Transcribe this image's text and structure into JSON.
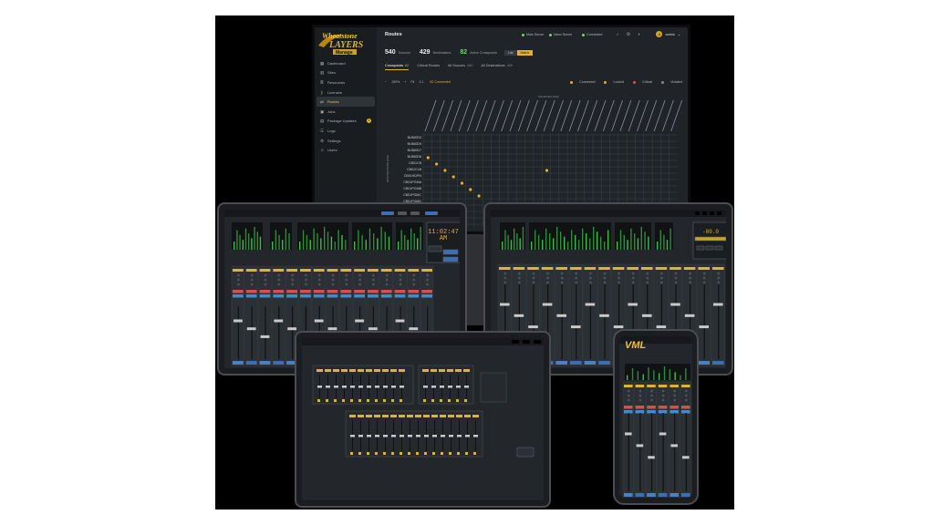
{
  "colors": {
    "accent": "#e3b12b",
    "green": "#6ed36e",
    "background": "#000000"
  },
  "logo": {
    "line1": "Wheatstone",
    "line2": "LAYERS",
    "line3": "Manage"
  },
  "sidebar": {
    "items": [
      {
        "label": "Dashboard",
        "icon": "grid-icon"
      },
      {
        "label": "Sites",
        "icon": "building-icon"
      },
      {
        "label": "Resources",
        "icon": "stack-icon"
      },
      {
        "label": "Licenses",
        "icon": "key-icon"
      },
      {
        "label": "Routes",
        "icon": "route-icon",
        "active": true
      },
      {
        "label": "Jobs",
        "icon": "briefcase-icon"
      },
      {
        "label": "Package Updates",
        "icon": "package-icon",
        "badge": "1"
      },
      {
        "label": "Logs",
        "icon": "list-icon"
      },
      {
        "label": "Settings",
        "icon": "gear-icon"
      },
      {
        "label": "Users",
        "icon": "users-icon"
      }
    ]
  },
  "header": {
    "title": "Routes",
    "main_server": "Main Server",
    "nano_server": "Nano Server",
    "connected": "Connected",
    "user": "admin",
    "user_initial": "A"
  },
  "stats": {
    "sources_count": "540",
    "sources_label": "Sources",
    "destinations_count": "429",
    "destinations_label": "Destinations",
    "crosspoints_count": "82",
    "crosspoints_label": "Active Crosspoints",
    "toggle": [
      "List",
      "Matrix"
    ]
  },
  "tabs": [
    {
      "label": "Crosspoints",
      "count": "82",
      "active": true
    },
    {
      "label": "Critical Routes",
      "count": ""
    },
    {
      "label": "All Sources",
      "count": "540"
    },
    {
      "label": "All Destinations",
      "count": "429"
    }
  ],
  "toolbar": {
    "minus": "−",
    "zoom": "100%",
    "plus": "+",
    "fit": "Fit",
    "reset": "1:1",
    "connected_count": "82 Connected",
    "legend": [
      {
        "label": "Connected",
        "color": "#e3b12b"
      },
      {
        "label": "Locked",
        "color": "#e3b12b"
      },
      {
        "label": "Critical",
        "color": "#e05050"
      },
      {
        "label": "Violated",
        "color": "#888888"
      }
    ]
  },
  "matrix": {
    "sources_title": "SOURCES (540)",
    "destinations_title": "DESTINATIONS (429)",
    "rows": [
      "BLB60D0",
      "BLB60D5",
      "BLB60D7",
      "BLB60D8",
      "CB01CB",
      "CB01CLB",
      "CB01HDPN",
      "CB01PGMA",
      "CB01PGMB",
      "CB01PGMC",
      "CB01PGMD",
      "CB01TTL",
      "Clip/LTC",
      "Connect"
    ]
  },
  "tablet_left": {
    "clock": "11:02:47",
    "ampm": "AM"
  },
  "tablet_right": {
    "level": "-80.0"
  },
  "phone": {
    "logo": "VML"
  }
}
